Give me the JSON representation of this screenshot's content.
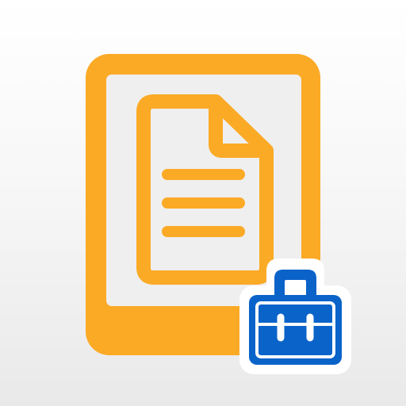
{
  "app_icon": {
    "icon_name": "mobile-document-briefcase-icon",
    "colors": {
      "background_top": "#ffffff",
      "background_bottom": "#e9e9e9",
      "tablet": "#fbaa26",
      "document_fill": "#efefef",
      "briefcase_blue": "#0a63c9",
      "briefcase_outline": "#ffffff"
    },
    "parts": {
      "tablet": "tablet-frame-icon",
      "document": "document-icon",
      "briefcase": "briefcase-icon"
    }
  }
}
